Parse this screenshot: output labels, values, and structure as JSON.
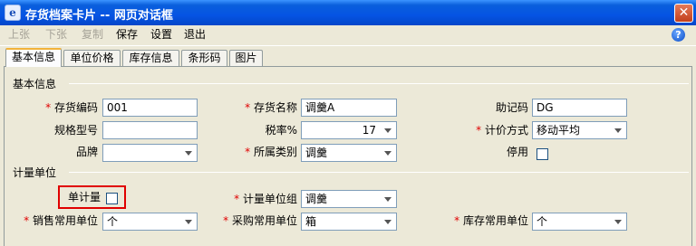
{
  "window": {
    "title": "存货档案卡片 -- 网页对话框",
    "app_icon_glyph": "e",
    "close_glyph": "✕"
  },
  "menu": {
    "items": [
      {
        "label": "上张",
        "enabled": false
      },
      {
        "label": "下张",
        "enabled": false
      },
      {
        "label": "复制",
        "enabled": false
      },
      {
        "label": "保存",
        "enabled": true
      },
      {
        "label": "设置",
        "enabled": true
      },
      {
        "label": "退出",
        "enabled": true
      }
    ],
    "help_glyph": "?"
  },
  "tabs": [
    {
      "label": "基本信息",
      "active": true
    },
    {
      "label": "单位价格",
      "active": false
    },
    {
      "label": "库存信息",
      "active": false
    },
    {
      "label": "条形码",
      "active": false
    },
    {
      "label": "图片",
      "active": false
    }
  ],
  "basic": {
    "section_title": "基本信息",
    "code_label": "存货编码",
    "code_value": "001",
    "name_label": "存货名称",
    "name_value": "调羹A",
    "mnemonic_label": "助记码",
    "mnemonic_value": "DG",
    "spec_label": "规格型号",
    "spec_value": "",
    "tax_label": "税率%",
    "tax_value": "17",
    "pricing_label": "计价方式",
    "pricing_value": "移动平均",
    "brand_label": "品牌",
    "brand_value": "",
    "category_label": "所属类别",
    "category_value": "调羹",
    "disabled_label": "停用"
  },
  "units": {
    "section_title": "计量单位",
    "single_label": "单计量",
    "group_label": "计量单位组",
    "group_value": "调羹",
    "sales_label": "销售常用单位",
    "sales_value": "个",
    "purchase_label": "采购常用单位",
    "purchase_value": "箱",
    "stock_label": "库存常用单位",
    "stock_value": "个"
  },
  "colors": {
    "required": "#e00000",
    "title_bar": "#0554e3",
    "highlight": "#e00000"
  }
}
